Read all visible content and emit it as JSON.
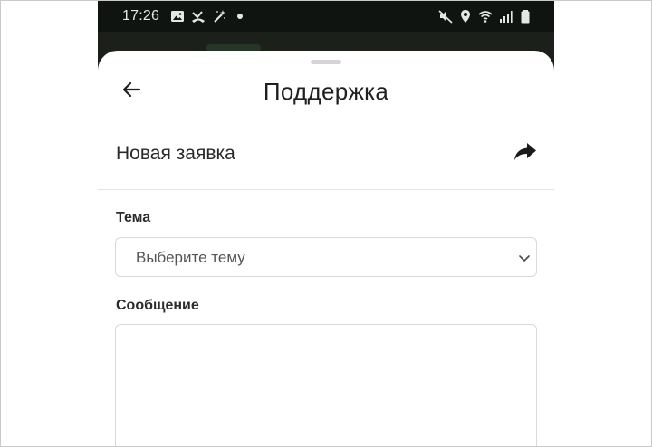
{
  "status_bar": {
    "time": "17:26",
    "left_icons": [
      "image-icon",
      "missed-call-icon",
      "magic-wand-icon",
      "dot-icon"
    ],
    "right_icons": [
      "mute-icon",
      "location-icon",
      "wifi-icon",
      "signal-icon",
      "battery-icon"
    ]
  },
  "header": {
    "title": "Поддержка",
    "back_icon": "arrow-left-icon"
  },
  "section": {
    "title": "Новая заявка",
    "share_icon": "share-icon"
  },
  "form": {
    "topic_label": "Тема",
    "topic_select_value": "Выберите тему",
    "message_label": "Сообщение",
    "message_value": ""
  },
  "colors": {
    "background": "#ffffff",
    "phone_dark": "#101410",
    "text_primary": "#1f1f1f",
    "border": "#d9d9d9"
  }
}
